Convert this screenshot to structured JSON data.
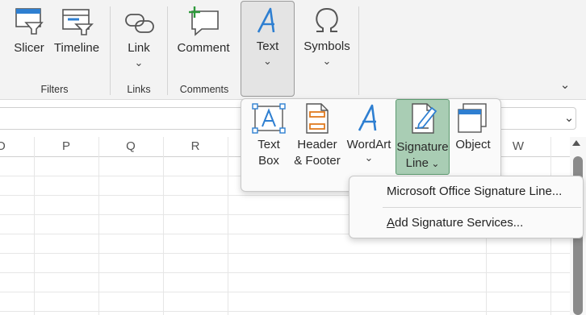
{
  "ribbon": {
    "buttons": {
      "slicer": "Slicer",
      "timeline": "Timeline",
      "link": "Link",
      "comment": "Comment",
      "text": "Text",
      "symbols": "Symbols"
    },
    "groups": {
      "filters": "Filters",
      "links": "Links",
      "comments": "Comments"
    }
  },
  "grid": {
    "columns": [
      "O",
      "P",
      "Q",
      "R",
      "W"
    ]
  },
  "text_panel": {
    "text_box": [
      "Text",
      "Box"
    ],
    "header_footer": [
      "Header",
      "& Footer"
    ],
    "wordart": "WordArt",
    "signature_line": [
      "Signature",
      "Line"
    ],
    "object": "Object"
  },
  "signature_menu": {
    "items": [
      {
        "label": "Microsoft Office Signature Line..."
      },
      {
        "label_prefix": "A",
        "label_rest": "dd Signature Services..."
      }
    ]
  },
  "colors": {
    "accent_blue": "#2e7fd1",
    "orange": "#e07a1f",
    "green_plus": "#2e9a3c",
    "active_green": "#a9cdb4"
  },
  "icons": [
    "slicer-icon",
    "timeline-icon",
    "link-icon",
    "comment-icon",
    "text-a-icon",
    "omega-icon",
    "text-box-icon",
    "header-footer-icon",
    "wordart-icon",
    "signature-line-icon",
    "object-icon",
    "collapse-ribbon-icon",
    "formula-expand-icon",
    "scroll-up-icon"
  ]
}
